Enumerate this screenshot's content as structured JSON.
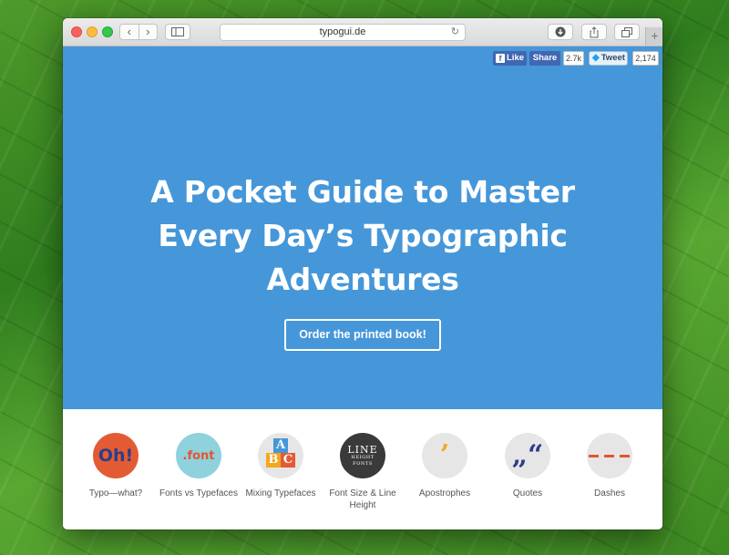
{
  "browser": {
    "url": "typogui.de",
    "back_glyph": "‹",
    "forward_glyph": "›",
    "new_tab_glyph": "+",
    "reload_glyph": "↻"
  },
  "social": {
    "like_label": "Like",
    "share_label": "Share",
    "share_count": "2.7k",
    "tweet_label": "Tweet",
    "tweet_count": "2,174"
  },
  "hero": {
    "headline": "A Pocket Guide to Master Every Day’s Typographic Adventures",
    "cta_label": "Order the printed book!",
    "background": "#4597d9"
  },
  "topics": [
    {
      "label": "Typo—what?",
      "icon_text": "Oh!"
    },
    {
      "label": "Fonts vs Typefaces",
      "icon_text": ".font"
    },
    {
      "label": "Mixing Typefaces",
      "icon_text": "ABC"
    },
    {
      "label": "Font Size & Line Height",
      "icon_text": "LINE",
      "icon_sub1": "HEIGHT",
      "icon_sub2": "FONTS"
    },
    {
      "label": "Apostrophes",
      "icon_text": "’"
    },
    {
      "label": "Quotes",
      "icon_text": "„“"
    },
    {
      "label": "Dashes",
      "icon_text": ""
    }
  ],
  "colors": {
    "accent_orange": "#e35b34",
    "accent_navy": "#2c3e88",
    "accent_teal": "#8fd1dd",
    "accent_yellow": "#f3a81c"
  }
}
